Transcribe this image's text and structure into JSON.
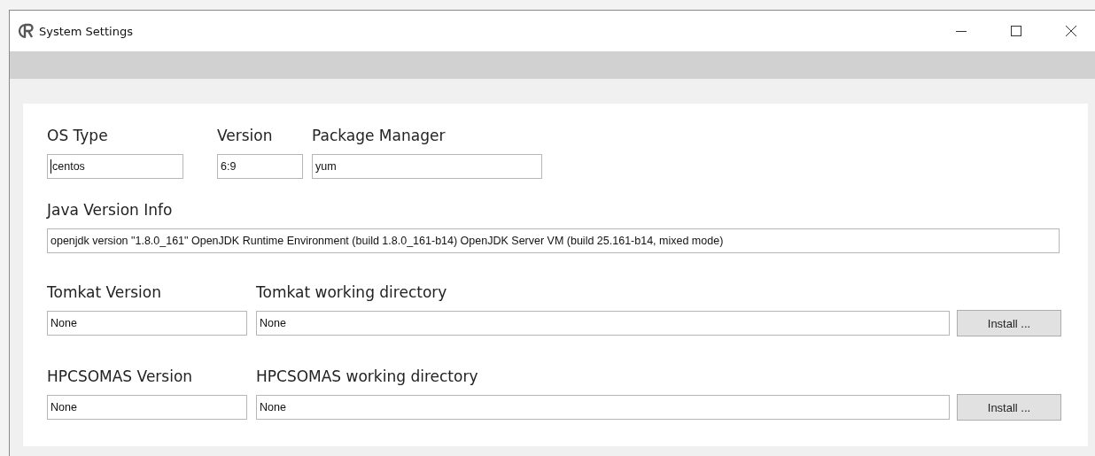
{
  "window": {
    "title": "System Settings"
  },
  "rows": [
    {
      "kind": "system",
      "fields": [
        {
          "label": "OS Type",
          "value": "centos",
          "focused": true
        },
        {
          "label": "Version",
          "value": "6:9",
          "focused": false
        },
        {
          "label": "Package Manager",
          "value": "yum",
          "focused": false
        }
      ]
    },
    {
      "kind": "java",
      "fields": [
        {
          "label": "Java Version Info",
          "value": "openjdk version \"1.8.0_161\" OpenJDK Runtime Environment (build 1.8.0_161-b14) OpenJDK Server VM (build 25.161-b14, mixed mode)",
          "focused": false
        }
      ]
    },
    {
      "kind": "install",
      "fields": [
        {
          "label": "Tomkat Version",
          "value": "None",
          "focused": false
        },
        {
          "label": "Tomkat working directory",
          "value": "None",
          "focused": false
        }
      ],
      "button": "Install ..."
    },
    {
      "kind": "install",
      "fields": [
        {
          "label": "HPCSOMAS Version",
          "value": "None",
          "focused": false
        },
        {
          "label": "HPCSOMAS working directory",
          "value": "None",
          "focused": false
        }
      ],
      "button": "Install ..."
    }
  ]
}
